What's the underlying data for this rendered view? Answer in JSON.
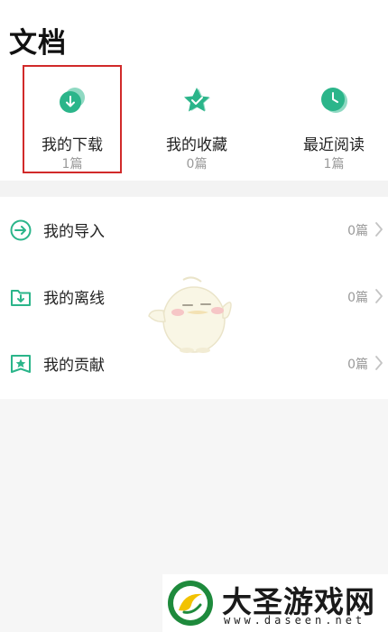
{
  "page": {
    "title": "文档"
  },
  "quick_actions": [
    {
      "label": "我的下载",
      "count": "1篇",
      "icon": "download-cloud-icon"
    },
    {
      "label": "我的收藏",
      "count": "0篇",
      "icon": "star-icon"
    },
    {
      "label": "最近阅读",
      "count": "1篇",
      "icon": "clock-icon"
    }
  ],
  "list": [
    {
      "label": "我的导入",
      "count": "0篇",
      "icon": "import-arrow-icon"
    },
    {
      "label": "我的离线",
      "count": "0篇",
      "icon": "offline-folder-icon"
    },
    {
      "label": "我的贡献",
      "count": "0篇",
      "icon": "contribution-bookmark-icon"
    }
  ],
  "watermark": {
    "name": "大圣游戏网",
    "url": "www.daseen.net"
  },
  "colors": {
    "accent": "#2bb58a",
    "highlight_border": "#d12a2a",
    "count_gray": "#9a9a9a"
  }
}
